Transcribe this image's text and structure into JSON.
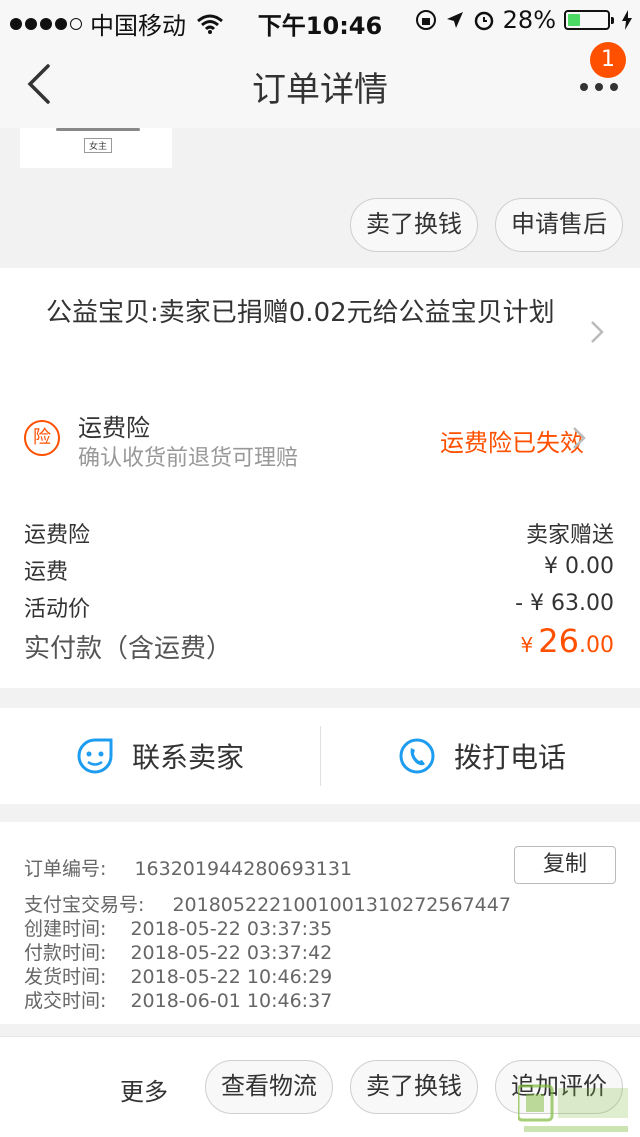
{
  "status_bar": {
    "carrier": "中国移动",
    "time": "下午10:46",
    "battery": "28%",
    "battery_level": 0.28
  },
  "nav": {
    "title": "订单详情",
    "badge": "1",
    "back_icon": "back-chevron-icon",
    "more_icon": "more-icon"
  },
  "product": {
    "tag": "女主"
  },
  "actions_top": {
    "sell": "卖了换钱",
    "aftersale": "申请售后"
  },
  "charity": {
    "text": "公益宝贝:卖家已捐赠0.02元给公益宝贝计划"
  },
  "insurance": {
    "icon_text": "险",
    "title": "运费险",
    "subtitle": "确认收货前退货可理赔",
    "status": "运费险已失效"
  },
  "summary": [
    {
      "label": "运费险",
      "value": "卖家赠送"
    },
    {
      "label": "运费",
      "value": "¥ 0.00"
    },
    {
      "label": "活动价",
      "value": "- ¥ 63.00"
    }
  ],
  "total": {
    "label": "实付款（含运费）",
    "currency": "¥",
    "integer": "26",
    "decimal": ".00"
  },
  "contact": {
    "seller": "联系卖家",
    "call": "拨打电话"
  },
  "order_info": {
    "number_label": "订单编号:",
    "number": "163201944280693131",
    "copy": "复制",
    "alipay_label": "支付宝交易号:",
    "alipay": "2018052221001001310272567447",
    "created_label": "创建时间:",
    "created": "2018-05-22 03:37:35",
    "paid_label": "付款时间:",
    "paid": "2018-05-22 03:37:42",
    "shipped_label": "发货时间:",
    "shipped": "2018-05-22 10:46:29",
    "completed_label": "成交时间:",
    "completed": "2018-06-01 10:46:37"
  },
  "footer": {
    "more": "更多",
    "logistics": "查看物流",
    "sell": "卖了换钱",
    "review": "追加评价"
  },
  "colors": {
    "accent": "#ff5000",
    "call_icon": "#1e9cf0"
  }
}
